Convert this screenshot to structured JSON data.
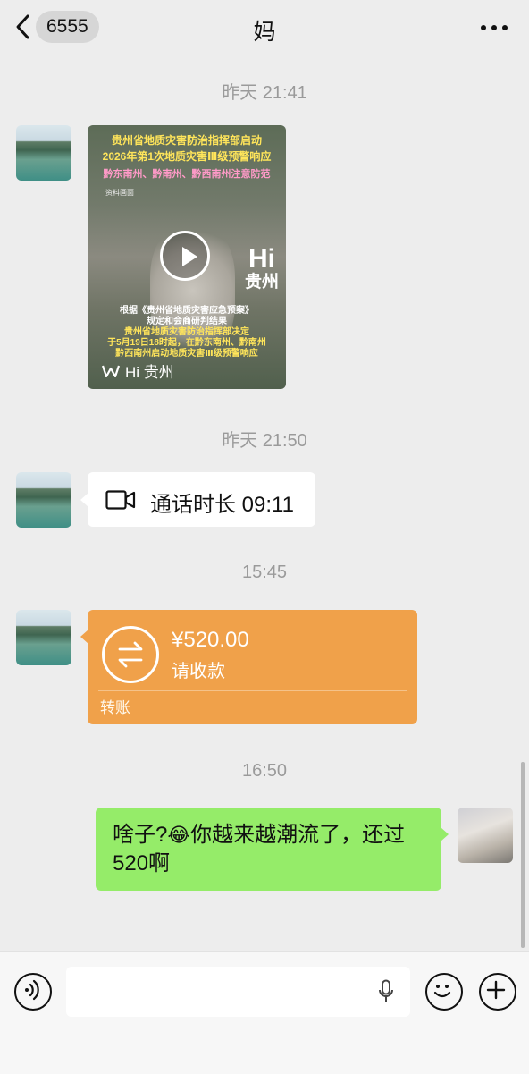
{
  "header": {
    "unread_count": "6555",
    "title": "妈"
  },
  "messages": {
    "time1": "昨天 21:41",
    "video": {
      "banner_line1": "贵州省地质灾害防治指挥部启动",
      "banner_line2": "2026年第1次地质灾害Ⅲ级预警响应",
      "banner_line3": "黔东南州、黔南州、黔西南州注意防范",
      "label": "资料画面",
      "logo_line1": "Hi",
      "logo_line2": "贵州",
      "bottom_line1": "根据《贵州省地质灾害应急预案》",
      "bottom_line2": "规定和会商研判结果",
      "bottom_line3": "贵州省地质灾害防治指挥部决定",
      "bottom_line4": "于5月19日18时起，在黔东南州、黔南州",
      "bottom_line5": "黔西南州启动地质灾害Ⅲ级预警响应",
      "brand": "Hi 贵州"
    },
    "time2": "昨天 21:50",
    "call": {
      "text": "通话时长 09:11"
    },
    "time3": "15:45",
    "transfer": {
      "amount": "¥520.00",
      "status": "请收款",
      "label": "转账"
    },
    "time4": "16:50",
    "outgoing": {
      "text_before": "啥子?",
      "emoji": "😂",
      "text_after": "你越来越潮流了，还过520啊"
    }
  },
  "colors": {
    "background": "#ededed",
    "green_bubble": "#95ec69",
    "transfer_orange": "#f0a14a"
  },
  "icons": [
    "back-chevron-icon",
    "more-icon",
    "video-call-icon",
    "transfer-arrows-icon",
    "voice-icon",
    "mic-icon",
    "emoji-icon",
    "plus-icon"
  ]
}
